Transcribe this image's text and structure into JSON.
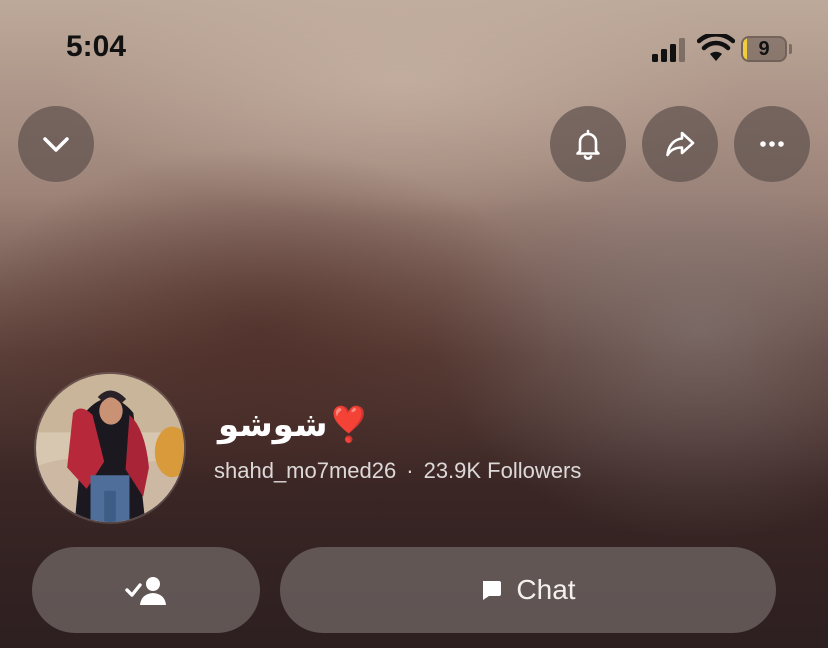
{
  "status_bar": {
    "time": "5:04",
    "battery_level": "9",
    "battery_fraction": 0.09,
    "battery_color": "#f2cd3b"
  },
  "header": {
    "icons": {
      "collapse": "chevron-down-icon",
      "notify": "bell-icon",
      "share": "share-arrow-icon",
      "more": "more-dots-icon"
    }
  },
  "profile": {
    "display_name": "شوشو❣️",
    "username": "shahd_mo7med26",
    "separator": "·",
    "followers": "23.9K Followers"
  },
  "actions": {
    "friend_icon": "added-friend-icon",
    "chat_icon": "chat-bubble-icon",
    "chat_label": "Chat"
  }
}
